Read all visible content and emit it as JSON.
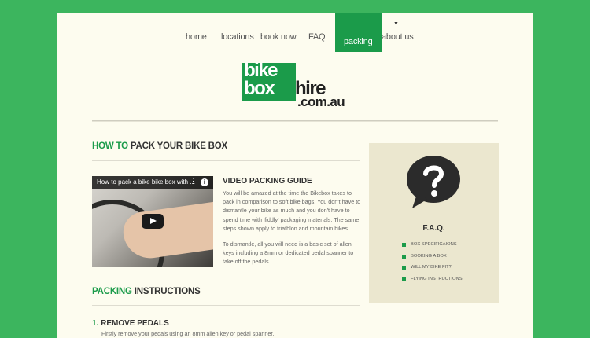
{
  "nav": {
    "items": [
      {
        "label": "home"
      },
      {
        "label": "locations"
      },
      {
        "label": "book now"
      },
      {
        "label": "FAQ"
      },
      {
        "label": "packing",
        "active": true
      },
      {
        "label": "about us"
      }
    ]
  },
  "logo": {
    "line1": "bike",
    "line2": "box",
    "line3": "hire",
    "line4": ".com.au"
  },
  "main": {
    "how_to": {
      "green": "HOW TO",
      "rest": " PACK YOUR BIKE BOX"
    },
    "video": {
      "title": "How to pack a bike bike box with ...",
      "menu": "⋮",
      "info": "i"
    },
    "guide_title": "VIDEO PACKING GUIDE",
    "guide_p1": "You will be amazed at the time the Bikebox takes to pack in comparison to soft bike bags. You don't have to dismantle your bike as much and you don't have to spend time with 'fiddly' packaging materials. The same steps shown apply to triathlon and mountain bikes.",
    "guide_p2": "To dismantle, all you will need is a basic set of allen keys including a 8mm or dedicated pedal spanner to take off the pedals.",
    "packing": {
      "green": "PACKING",
      "rest": " INSTRUCTIONS"
    },
    "step1": {
      "num": "1.",
      "title": " REMOVE PEDALS",
      "text": "Firstly remove your pedals using an 8mm allen key or pedal spanner."
    }
  },
  "sidebar": {
    "title": "F.A.Q.",
    "items": [
      {
        "label": "BOX SPECIFICAIONS"
      },
      {
        "label": "BOOKING A BOX"
      },
      {
        "label": "WILL MY BIKE FIT?"
      },
      {
        "label": "FLYING INSTRUCTIONS"
      }
    ]
  },
  "colors": {
    "accent": "#1b9b4a",
    "background": "#3cb55e",
    "page": "#fdfcef",
    "sidebar": "#ebe7cf"
  }
}
